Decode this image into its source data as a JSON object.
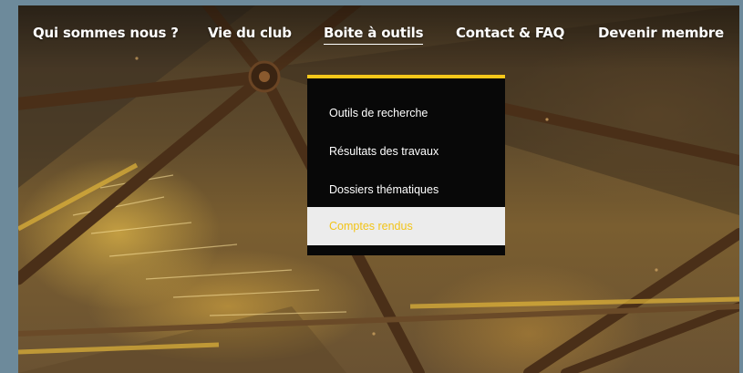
{
  "nav": {
    "items": [
      {
        "label": "Qui sommes nous ?"
      },
      {
        "label": "Vie du club"
      },
      {
        "label": "Boite à outils"
      },
      {
        "label": "Contact & FAQ"
      },
      {
        "label": "Devenir membre"
      }
    ],
    "active_index": 2
  },
  "dropdown": {
    "items": [
      {
        "label": "Outils de recherche"
      },
      {
        "label": "Résultats des travaux"
      },
      {
        "label": "Dossiers thématiques"
      },
      {
        "label": "Comptes rendus"
      }
    ],
    "highlighted_index": 3
  },
  "colors": {
    "accent": "#f6c71a",
    "dropdown_bg": "#080808",
    "highlight_bg": "#ececec",
    "frame_bg": "#6d8a9b"
  },
  "icons": {
    "background": "geodesic-dome-photo"
  }
}
